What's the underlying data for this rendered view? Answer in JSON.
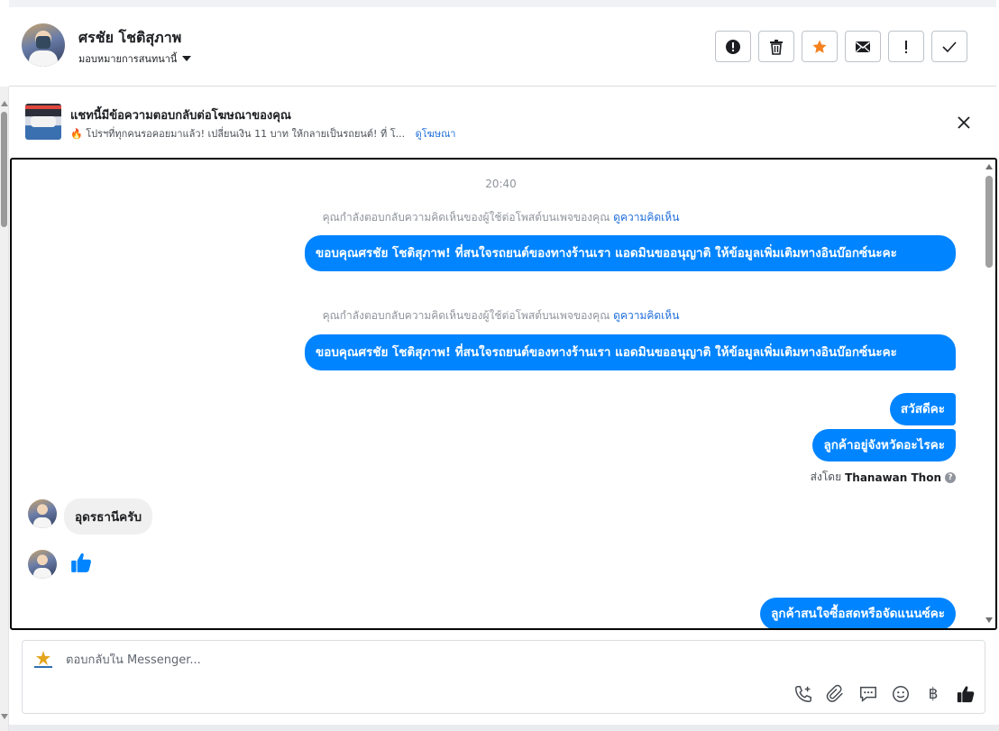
{
  "header": {
    "name": "ศรชัย โชติสุภาพ",
    "assign_label": "มอบหมายการสนทนานี้",
    "actions": [
      {
        "icon": "alert-circle-icon"
      },
      {
        "icon": "trash-icon"
      },
      {
        "icon": "star-icon",
        "color": "#f5821f"
      },
      {
        "icon": "envelope-icon"
      },
      {
        "icon": "exclamation-icon"
      },
      {
        "icon": "check-icon"
      }
    ]
  },
  "ad": {
    "title": "แชทนี้มีข้อความตอบกลับต่อโฆษณาของคุณ",
    "subtitle": "🔥 โปรฯที่ทุกคนรอคอยมาแล้ว! เปลี่ยนเงิน 11 บาท ให้กลายเป็นรถยนต์! ที่ โ...",
    "link": "ดูโฆษณา"
  },
  "chat": {
    "time": "20:40",
    "notice_text": "คุณกำลังตอบกลับความคิดเห็นของผู้ใช้ต่อโพสต์บนเพจของคุณ",
    "notice_link": "ดูความคิดเห็น",
    "outgoing_long": "ขอบคุณศรชัย โชติสุภาพ! ที่สนใจรถยนต์ของทางร้านเรา แอดมินขออนุญาติ ให้ข้อมูลเพิ่มเติมทางอินบ๊อกซ์นะคะ",
    "greeting": "สวัสดีคะ",
    "ask_province": "ลูกค้าอยู่จังหวัดอะไรคะ",
    "sent_by_prefix": "ส่งโดย",
    "sent_by_name": "Thanawan Thon",
    "reply_province": "อุดรธานีครับ",
    "ask_purchase": "ลูกค้าสนใจซื้อสดหรือจัดแนนซ์คะ",
    "accent_color": "#0084ff"
  },
  "composer": {
    "placeholder": "ตอบกลับใน Messenger...",
    "tools": [
      "phone-add-icon",
      "paperclip-icon",
      "chat-bubble-icon",
      "smiley-icon",
      "baht-icon",
      "thumbs-up-icon"
    ],
    "baht_symbol": "฿"
  }
}
